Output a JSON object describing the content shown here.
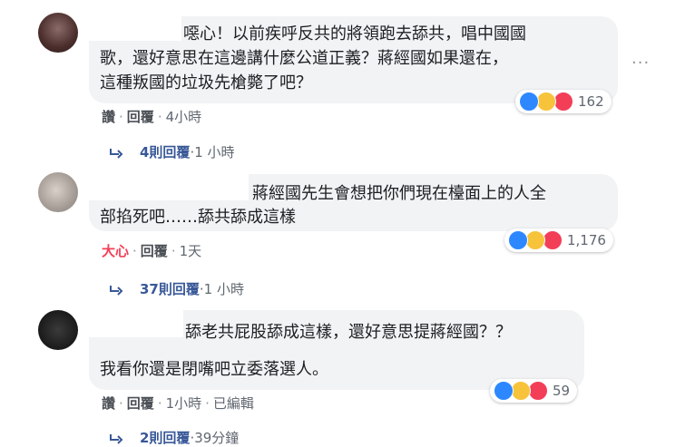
{
  "comments": [
    {
      "text_lines": [
        "噁心！以前疾呼反共的將領跑去舔共，唱中國國",
        "歌，還好意思在這邊講什麼公道正義？蔣經國如果還在，",
        "這種叛國的垃圾先槍斃了吧？"
      ],
      "actions": [
        "讚",
        "回覆",
        "4小時"
      ],
      "reaction_count": "162",
      "replies": "4則回覆",
      "replies_time": "1 小時"
    },
    {
      "text_lines": [
        "蔣經國先生會想把你們現在檯面上的人全",
        "部掐死吧……舔共舔成這樣"
      ],
      "actions": [
        "大心",
        "回覆",
        "1天"
      ],
      "reaction_count": "1,176",
      "replies": "37則回覆",
      "replies_time": "1 小時"
    },
    {
      "text_lines": [
        "舔老共屁股舔成這樣，還好意思提蔣經國？？",
        "我看你還是閉嘴吧立委落選人。"
      ],
      "actions": [
        "讚",
        "回覆",
        "1小時",
        "已編輯"
      ],
      "reaction_count": "59",
      "replies": "2則回覆",
      "replies_time": "39分鐘"
    }
  ],
  "more_options": "···",
  "colors": {
    "bubble": "#f2f3f5",
    "link": "#385898",
    "love": "#f33e58",
    "like": "#2d88ff",
    "haha": "#f7c33b"
  },
  "icons": [
    "like-icon",
    "haha-icon",
    "love-icon",
    "reply-arrow-icon",
    "more-options-icon"
  ]
}
